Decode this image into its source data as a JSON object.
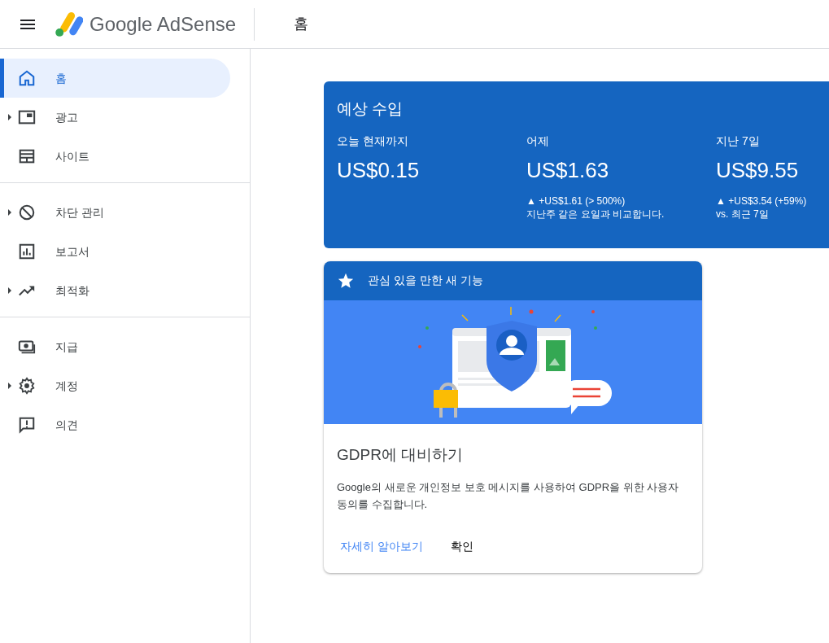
{
  "header": {
    "product": "Google AdSense",
    "page_title": "홈"
  },
  "sidebar": {
    "groups": [
      [
        {
          "label": "홈",
          "kind": "home",
          "expandable": false,
          "selected": true
        },
        {
          "label": "광고",
          "kind": "ads",
          "expandable": true,
          "selected": false
        },
        {
          "label": "사이트",
          "kind": "sites",
          "expandable": false,
          "selected": false
        }
      ],
      [
        {
          "label": "차단 관리",
          "kind": "block",
          "expandable": true,
          "selected": false
        },
        {
          "label": "보고서",
          "kind": "reports",
          "expandable": false,
          "selected": false
        },
        {
          "label": "최적화",
          "kind": "optimize",
          "expandable": true,
          "selected": false
        }
      ],
      [
        {
          "label": "지급",
          "kind": "payments",
          "expandable": false,
          "selected": false
        },
        {
          "label": "계정",
          "kind": "account",
          "expandable": true,
          "selected": false
        },
        {
          "label": "의견",
          "kind": "feedback",
          "expandable": false,
          "selected": false
        }
      ]
    ]
  },
  "earnings": {
    "title": "예상 수입",
    "columns": [
      {
        "label": "오늘 현재까지",
        "amount": "US$0.15"
      },
      {
        "label": "어제",
        "amount": "US$1.63",
        "change": "▲ +US$1.61 (> 500%)",
        "note": "지난주 같은 요일과 비교합니다."
      },
      {
        "label": "지난 7일",
        "amount": "US$9.55",
        "change": "▲ +US$3.54 (+59%)",
        "note": "vs. 최근 7일"
      }
    ]
  },
  "feature_card": {
    "header": "관심 있을 만한 새 기능",
    "title": "GDPR에 대비하기",
    "body": "Google의 새로운 개인정보 보호 메시지를 사용하여 GDPR을 위한 사용자 동의를 수집합니다.",
    "actions": [
      {
        "label": "자세히 알아보기",
        "kind": "link"
      },
      {
        "label": "확인",
        "kind": "plain"
      }
    ]
  }
}
